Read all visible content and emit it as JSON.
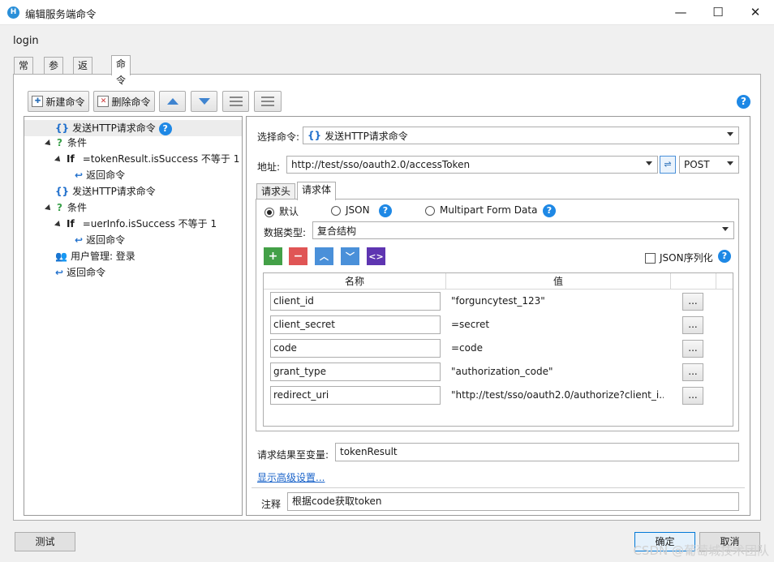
{
  "window": {
    "title": "编辑服务端命令",
    "minimize": "—",
    "maximize": "☐",
    "close": "✕"
  },
  "form_name": "login",
  "tabs": [
    "常规",
    "参数",
    "返回值",
    "命令"
  ],
  "toolbar": {
    "new_command": "新建命令",
    "delete_command": "删除命令"
  },
  "tree": [
    {
      "label": "发送HTTP请求命令",
      "icon": "http-request-icon"
    },
    {
      "label": "条件",
      "icon": "condition-icon"
    },
    {
      "keyword": "If",
      "label": "=tokenResult.isSuccess 不等于 1"
    },
    {
      "label": "返回命令",
      "icon": "return-icon"
    },
    {
      "label": "发送HTTP请求命令",
      "icon": "http-request-icon"
    },
    {
      "label": "条件",
      "icon": "condition-icon"
    },
    {
      "keyword": "If",
      "label": "=uerInfo.isSuccess 不等于 1"
    },
    {
      "label": "返回命令",
      "icon": "return-icon"
    },
    {
      "label": "用户管理: 登录",
      "icon": "users-icon"
    },
    {
      "label": "返回命令",
      "icon": "return-icon"
    }
  ],
  "detail": {
    "select_command_label": "选择命令:",
    "select_command_value": "发送HTTP请求命令",
    "address_label": "地址:",
    "address_value": "http://test/sso/oauth2.0/accessToken",
    "method_value": "POST",
    "inner_tabs": [
      "请求头",
      "请求体"
    ],
    "radio_default": "默认",
    "radio_json": "JSON",
    "radio_multipart": "Multipart Form Data",
    "data_type_label": "数据类型:",
    "data_type_value": "复合结构",
    "json_serialize_label": "JSON序列化",
    "grid_headers": [
      "名称",
      "值"
    ],
    "rows": [
      {
        "name": "client_id",
        "value": "\"forguncytest_123\""
      },
      {
        "name": "client_secret",
        "value": "=secret"
      },
      {
        "name": "code",
        "value": "=code"
      },
      {
        "name": "grant_type",
        "value": "\"authorization_code\""
      },
      {
        "name": "redirect_uri",
        "value": "\"http://test/sso/oauth2.0/authorize?client_i..."
      }
    ],
    "dots": "...",
    "result_var_label": "请求结果至变量:",
    "result_var_value": "tokenResult",
    "advanced_link": "显示高级设置...",
    "comment_label": "注释",
    "comment_value": "根据code获取token"
  },
  "footer": {
    "test_button": "测试",
    "ok_button": "确定",
    "cancel_button": "取消"
  },
  "watermark": "CSDN @葡萄城技术团队",
  "colors": {
    "accent": "#1e88e5",
    "add_button": "#43a047",
    "delete_button": "#e05555",
    "move_buttons": "#4a90d9",
    "code_button": "#5e35b1"
  }
}
